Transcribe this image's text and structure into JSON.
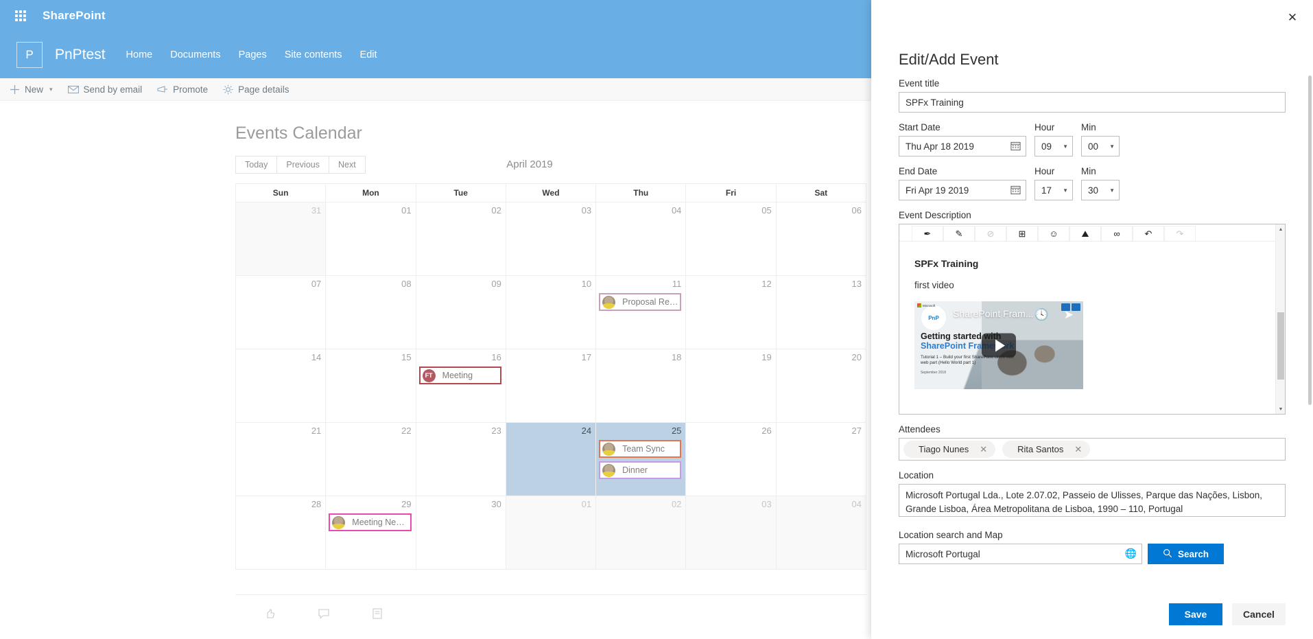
{
  "suite": {
    "waffle_icon": "app-launcher-icon",
    "title": "SharePoint"
  },
  "site": {
    "logo_letter": "P",
    "name": "PnPtest",
    "nav": [
      {
        "label": "Home"
      },
      {
        "label": "Documents"
      },
      {
        "label": "Pages"
      },
      {
        "label": "Site contents"
      },
      {
        "label": "Edit"
      }
    ]
  },
  "command_bar": [
    {
      "label": "New",
      "icon": "plus-icon",
      "chevron": "⌄"
    },
    {
      "label": "Send by email",
      "icon": "mail-icon"
    },
    {
      "label": "Promote",
      "icon": "megaphone-icon"
    },
    {
      "label": "Page details",
      "icon": "gear-icon"
    }
  ],
  "calendar": {
    "title": "Events Calendar",
    "buttons": {
      "today": "Today",
      "previous": "Previous",
      "next": "Next"
    },
    "month_label": "April 2019",
    "weekday_headers": [
      "Sun",
      "Mon",
      "Tue",
      "Wed",
      "Thu",
      "Fri",
      "Sat"
    ],
    "weeks": [
      [
        {
          "day": "31",
          "other": true,
          "events": []
        },
        {
          "day": "01",
          "other": false,
          "events": []
        },
        {
          "day": "02",
          "other": false,
          "events": []
        },
        {
          "day": "03",
          "other": false,
          "events": []
        },
        {
          "day": "04",
          "other": false,
          "events": []
        },
        {
          "day": "05",
          "other": false,
          "events": []
        },
        {
          "day": "06",
          "other": false,
          "events": []
        }
      ],
      [
        {
          "day": "07",
          "other": false,
          "events": []
        },
        {
          "day": "08",
          "other": false,
          "events": []
        },
        {
          "day": "09",
          "other": false,
          "events": []
        },
        {
          "day": "10",
          "other": false,
          "events": []
        },
        {
          "day": "11",
          "other": false,
          "events": [
            {
              "title": "Proposal Review",
              "color": "purple",
              "avatar": "photo",
              "initials": ""
            }
          ]
        },
        {
          "day": "12",
          "other": false,
          "events": []
        },
        {
          "day": "13",
          "other": false,
          "events": []
        }
      ],
      [
        {
          "day": "14",
          "other": false,
          "events": []
        },
        {
          "day": "15",
          "other": false,
          "events": []
        },
        {
          "day": "16",
          "other": false,
          "events": [
            {
              "title": "Meeting",
              "color": "red",
              "avatar": "initials",
              "initials": "FT"
            }
          ]
        },
        {
          "day": "17",
          "other": false,
          "events": []
        },
        {
          "day": "18",
          "other": false,
          "events": []
        },
        {
          "day": "19",
          "other": false,
          "events": []
        },
        {
          "day": "20",
          "other": false,
          "events": []
        }
      ],
      [
        {
          "day": "21",
          "other": false,
          "events": []
        },
        {
          "day": "22",
          "other": false,
          "events": []
        },
        {
          "day": "23",
          "other": false,
          "events": []
        },
        {
          "day": "24",
          "other": false,
          "today": true,
          "events": []
        },
        {
          "day": "25",
          "other": false,
          "today": true,
          "events": [
            {
              "title": "Team Sync",
              "color": "orange",
              "avatar": "photo",
              "initials": ""
            },
            {
              "title": "Dinner",
              "color": "lilac",
              "avatar": "photo",
              "initials": ""
            }
          ]
        },
        {
          "day": "26",
          "other": false,
          "events": []
        },
        {
          "day": "27",
          "other": false,
          "events": []
        }
      ],
      [
        {
          "day": "28",
          "other": false,
          "events": []
        },
        {
          "day": "29",
          "other": false,
          "events": [
            {
              "title": "Meeting New P...",
              "color": "pink",
              "avatar": "photo",
              "initials": ""
            }
          ]
        },
        {
          "day": "30",
          "other": false,
          "events": []
        },
        {
          "day": "01",
          "other": true,
          "events": []
        },
        {
          "day": "02",
          "other": true,
          "events": []
        },
        {
          "day": "03",
          "other": true,
          "events": []
        },
        {
          "day": "04",
          "other": true,
          "events": []
        }
      ]
    ]
  },
  "panel": {
    "close_icon": "close-icon",
    "title": "Edit/Add Event",
    "event_title": {
      "label": "Event title",
      "value": "SPFx Training",
      "placeholder": ""
    },
    "start_date": {
      "label": "Start Date",
      "value": "Thu Apr 18 2019"
    },
    "start_hour": {
      "label": "Hour",
      "value": "09"
    },
    "start_min": {
      "label": "Min",
      "value": "00"
    },
    "end_date": {
      "label": "End Date",
      "value": "Fri Apr 19 2019"
    },
    "end_hour": {
      "label": "Hour",
      "value": "17"
    },
    "end_min": {
      "label": "Min",
      "value": "30"
    },
    "description": {
      "label": "Event Description",
      "toolbar": [
        {
          "icon": "pen-icon",
          "glyph": "✒",
          "dim": false
        },
        {
          "icon": "highlighter-icon",
          "glyph": "✎",
          "dim": false
        },
        {
          "icon": "eraser-icon",
          "glyph": "⊘",
          "dim": true
        },
        {
          "icon": "table-icon",
          "glyph": "⊞",
          "dim": false
        },
        {
          "icon": "emoji-icon",
          "glyph": "☺",
          "dim": false
        },
        {
          "icon": "image-icon",
          "glyph": "⛰",
          "dim": false
        },
        {
          "icon": "link-icon",
          "glyph": "∞",
          "dim": false
        },
        {
          "icon": "undo-icon",
          "glyph": "↶",
          "dim": false
        },
        {
          "icon": "redo-icon",
          "glyph": "↷",
          "dim": true
        }
      ],
      "heading": "SPFx Training",
      "paragraph": "first video",
      "video": {
        "channel_badge": "PnP",
        "overlay_title": "SharePoint Fram...",
        "line1": "Getting started with",
        "line2": "SharePoint Framework",
        "line3": "Tutorial 1 – Build your first SharePoint client-side web part (Hello World part 1)",
        "line4": "September 2018",
        "brand": "Microsoft",
        "play_icon": "play-icon",
        "clock_icon": "watch-later-icon",
        "share_icon": "share-icon"
      },
      "scroll_up_icon": "caret-up-icon",
      "scroll_down_icon": "caret-down-icon"
    },
    "attendees": {
      "label": "Attendees",
      "items": [
        {
          "name": "Tiago Nunes",
          "remove_icon": "close-icon"
        },
        {
          "name": "Rita Santos",
          "remove_icon": "close-icon"
        }
      ]
    },
    "location": {
      "label": "Location",
      "value": "Microsoft Portugal Lda., Lote 2.07.02, Passeio de Ulisses, Parque das Nações, Lisbon, Grande Lisboa, Área Metropolitana de Lisboa, 1990 – 110, Portugal"
    },
    "location_search": {
      "label": "Location search and Map",
      "value": "Microsoft Portugal",
      "globe_icon": "globe-icon",
      "button_label": "Search",
      "button_icon": "search-icon"
    },
    "footer": {
      "save_label": "Save",
      "cancel_label": "Cancel"
    }
  },
  "colors": {
    "sharepoint_blue": "#69afe5",
    "accent_blue": "#0078d4",
    "today_cell": "#bcd2e4"
  }
}
